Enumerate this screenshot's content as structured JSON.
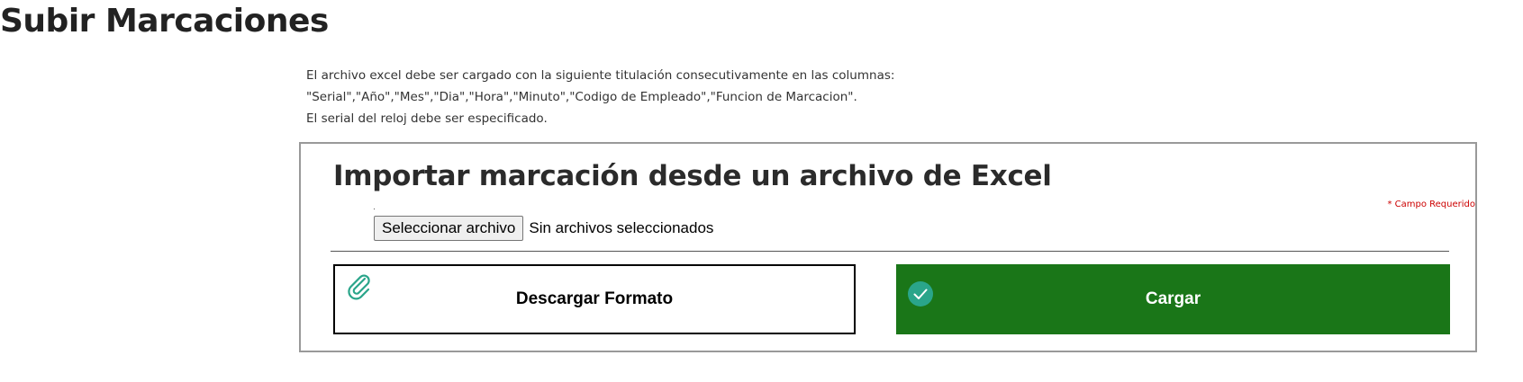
{
  "page": {
    "title": "Subir Marcaciones"
  },
  "instructions": {
    "line1": "El archivo excel debe ser cargado con la siguiente titulación consecutivamente en las columnas:",
    "line2": "\"Serial\",\"Año\",\"Mes\",\"Dia\",\"Hora\",\"Minuto\",\"Codigo de Empleado\",\"Funcion de Marcacion\".",
    "line3": "El serial del reloj debe ser especificado."
  },
  "import_form": {
    "title": "Importar marcación desde un archivo de Excel",
    "required_note": "* Campo Requerido",
    "file_button_label": "Seleccionar archivo",
    "file_status": "Sin archivos seleccionados",
    "download_button": {
      "label": "Descargar Formato",
      "icon": "paperclip-icon"
    },
    "upload_button": {
      "label": "Cargar",
      "icon": "check-circle-icon"
    }
  },
  "colors": {
    "upload_bg": "#1a7618",
    "icon_teal": "#2aa58a",
    "required_red": "#cc0000"
  }
}
